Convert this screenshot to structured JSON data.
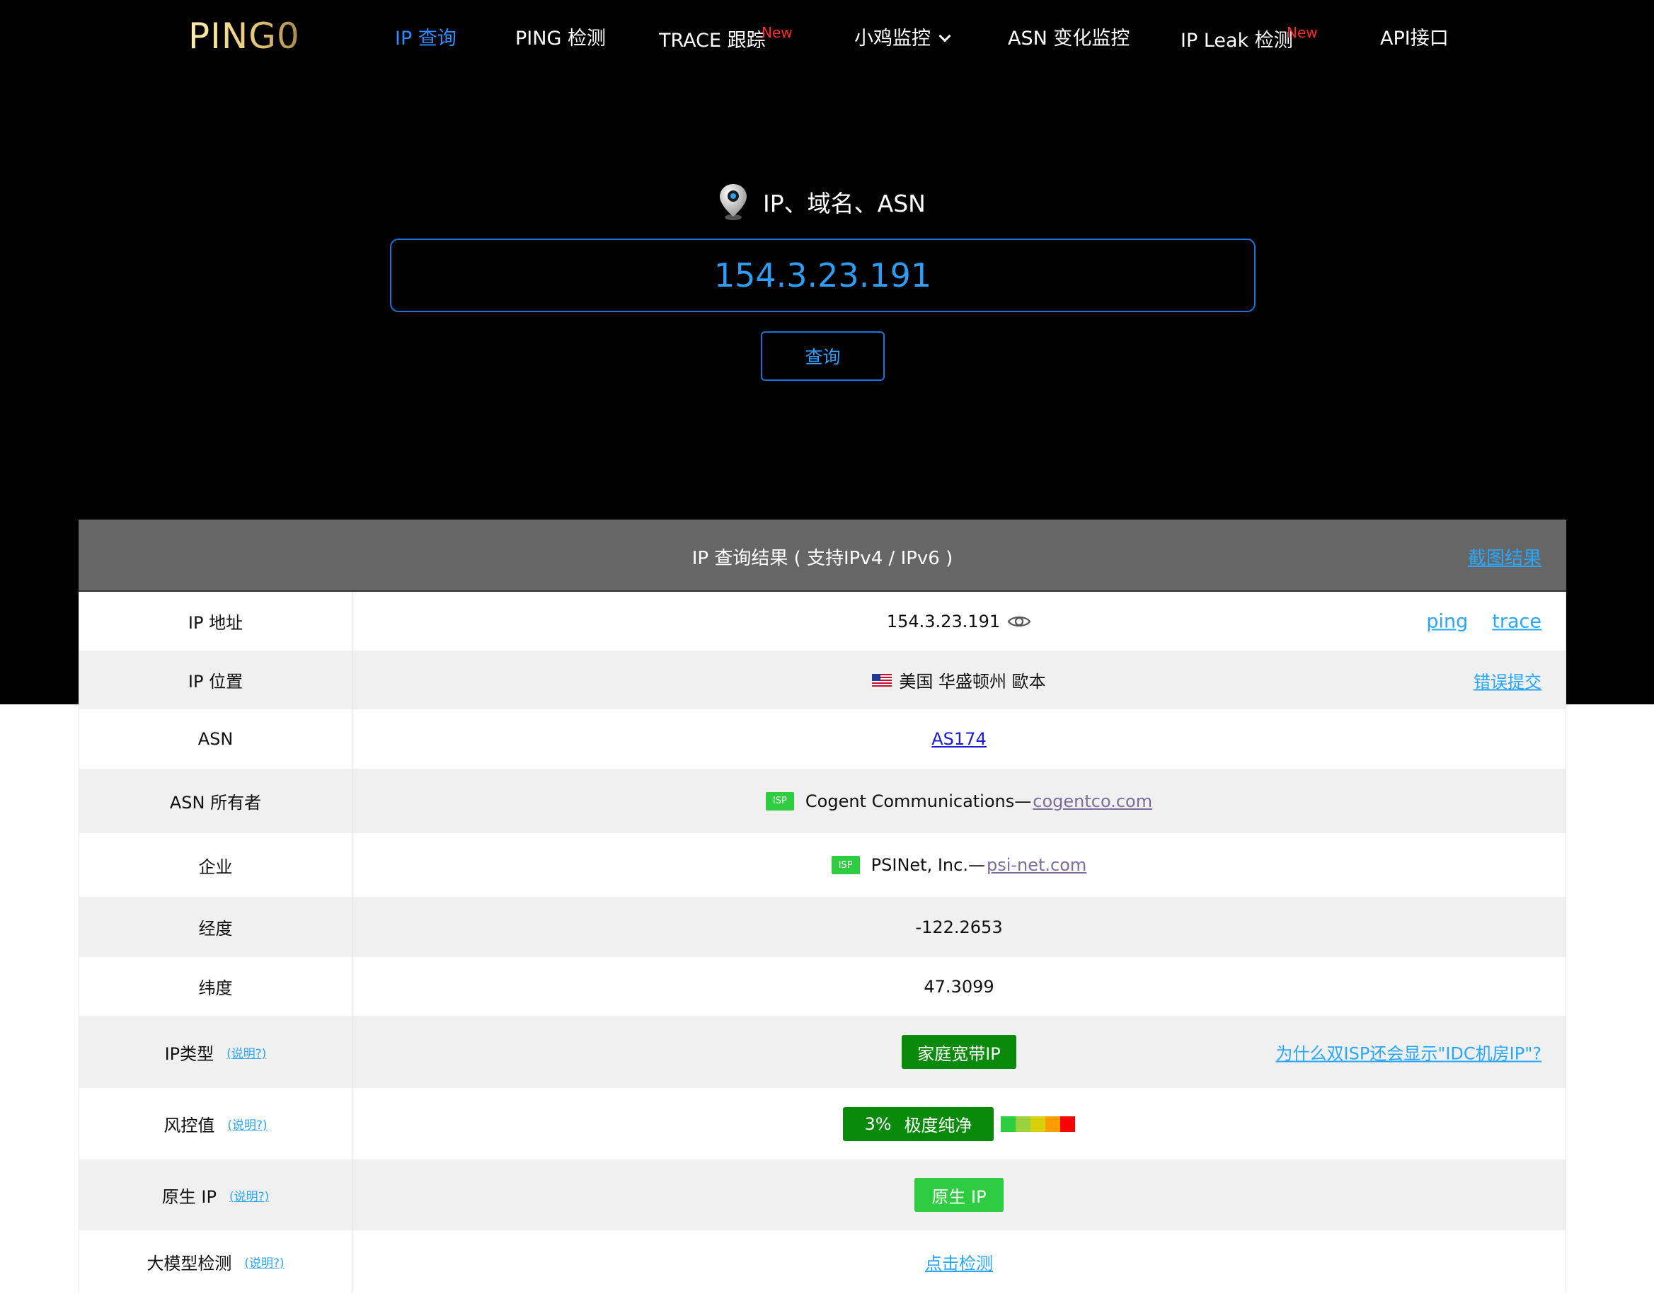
{
  "nav": {
    "logo": "PING0",
    "items": [
      {
        "label": "IP 查询",
        "active": true
      },
      {
        "label": "PING 检测"
      },
      {
        "label": "TRACE 跟踪",
        "badge": "New"
      },
      {
        "label": "小鸡监控",
        "dropdown": true
      },
      {
        "label": "ASN 变化监控"
      },
      {
        "label": "IP Leak 检测",
        "badge": "New"
      },
      {
        "label": "API接口"
      }
    ]
  },
  "search": {
    "label": "IP、域名、ASN",
    "value": "154.3.23.191",
    "button": "查询",
    "icon": "map-pin-icon"
  },
  "result": {
    "title": "IP 查询结果 ( 支持IPv4 / IPv6 )",
    "screenshot_link": "截图结果",
    "rows": {
      "ip_address": {
        "label": "IP 地址",
        "value": "154.3.23.191",
        "links": [
          "ping",
          "trace"
        ]
      },
      "ip_location": {
        "label": "IP 位置",
        "flag": "🇺🇸",
        "value": "美国 华盛顿州 歐本",
        "link": "错误提交"
      },
      "asn": {
        "label": "ASN",
        "value": "AS174"
      },
      "asn_owner": {
        "label": "ASN 所有者",
        "badge": "ISP",
        "value": "Cogent Communications—",
        "domain": "cogentco.com"
      },
      "org": {
        "label": "企业",
        "badge": "ISP",
        "value": "PSINet, Inc.—",
        "domain": "psi-net.com"
      },
      "longitude": {
        "label": "经度",
        "value": "-122.2653"
      },
      "latitude": {
        "label": "纬度",
        "value": "47.3099"
      },
      "ip_type": {
        "label": "IP类型",
        "explain": "(说明?)",
        "value": "家庭宽带IP",
        "link": "为什么双ISP还会显示\"IDC机房IP\"?"
      },
      "risk": {
        "label": "风控值",
        "explain": "(说明?)",
        "percent": "3%",
        "value": "极度纯净",
        "scale_colors": [
          "#2ecc40",
          "#9ad13c",
          "#d8d10a",
          "#ff9c00",
          "#ff0000"
        ]
      },
      "native_ip": {
        "label": "原生 IP",
        "explain": "(说明?)",
        "value": "原生 IP"
      },
      "llm_check": {
        "label": "大模型检测",
        "explain": "(说明?)",
        "value": "点击检测"
      }
    }
  },
  "colors": {
    "accent": "#29a6ff",
    "nav_active": "#2f8cff",
    "badge_new": "#ff2a2a",
    "green_dark": "#0a8a0a",
    "green_light": "#2ecc40",
    "header_bg": "#666666"
  }
}
